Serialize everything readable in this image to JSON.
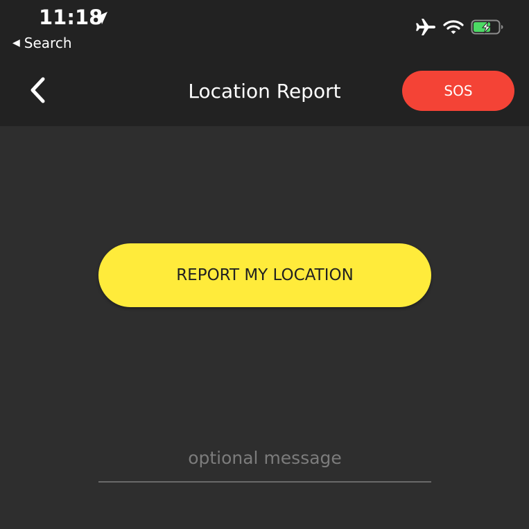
{
  "status_bar": {
    "time": "11:18",
    "location_icon": "location-arrow-icon",
    "back_to_app": "Search",
    "back_to_app_icon": "back-triangle-icon",
    "icons": [
      "airplane-icon",
      "wifi-icon",
      "battery-charging-icon"
    ]
  },
  "header": {
    "back_icon": "chevron-left-icon",
    "title": "Location Report",
    "sos_label": "SOS"
  },
  "main": {
    "report_button_label": "REPORT MY LOCATION",
    "message_placeholder": "optional message",
    "message_value": ""
  },
  "colors": {
    "background": "#2e2e2e",
    "header_background": "#222222",
    "sos": "#f44336",
    "report_button": "#ffeb3b",
    "battery_green": "#4cd964"
  }
}
